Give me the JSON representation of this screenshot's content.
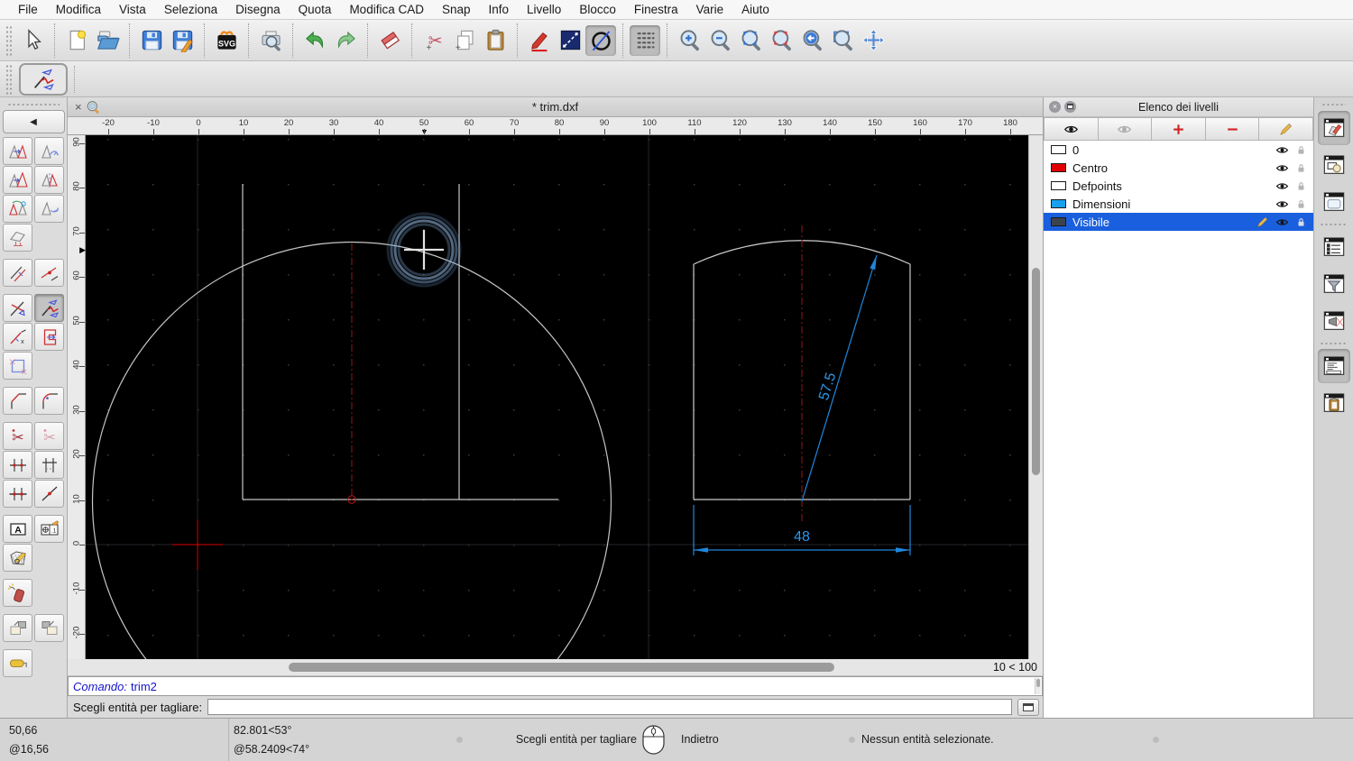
{
  "menu": {
    "items": [
      "File",
      "Modifica",
      "Vista",
      "Seleziona",
      "Disegna",
      "Quota",
      "Modifica CAD",
      "Snap",
      "Info",
      "Livello",
      "Blocco",
      "Finestra",
      "Varie",
      "Aiuto"
    ]
  },
  "toolbar": {
    "buttons": [
      {
        "name": "selection-arrow-icon",
        "icon": "cursor"
      },
      {
        "sep": true
      },
      {
        "name": "new-document-icon",
        "icon": "newfile"
      },
      {
        "name": "open-document-icon",
        "icon": "open"
      },
      {
        "sep": true
      },
      {
        "name": "save-icon",
        "icon": "save"
      },
      {
        "name": "save-as-icon",
        "icon": "saveas"
      },
      {
        "sep": true
      },
      {
        "name": "svg-export-icon",
        "icon": "svg"
      },
      {
        "sep": true
      },
      {
        "name": "print-preview-icon",
        "icon": "printprev"
      },
      {
        "sep": true
      },
      {
        "name": "undo-icon",
        "icon": "undo"
      },
      {
        "name": "redo-icon",
        "icon": "redo"
      },
      {
        "sep": true
      },
      {
        "name": "delete-icon",
        "icon": "eraser"
      },
      {
        "sep": true
      },
      {
        "name": "cut-icon",
        "icon": "cut"
      },
      {
        "name": "copy-icon",
        "icon": "copy"
      },
      {
        "name": "paste-icon",
        "icon": "paste"
      },
      {
        "sep": true
      },
      {
        "name": "edit-pencil-icon",
        "icon": "pencil"
      },
      {
        "name": "measure-icon",
        "icon": "measure"
      },
      {
        "name": "snap-free-icon",
        "icon": "snapfree",
        "active": true
      },
      {
        "sep": true
      },
      {
        "name": "grid-toggle-icon",
        "icon": "grid",
        "active": true
      },
      {
        "sep": true
      },
      {
        "name": "zoom-in-icon",
        "icon": "zin"
      },
      {
        "name": "zoom-out-icon",
        "icon": "zout"
      },
      {
        "name": "zoom-auto-icon",
        "icon": "zauto"
      },
      {
        "name": "zoom-previous-icon",
        "icon": "zprev"
      },
      {
        "name": "zoom-back-icon",
        "icon": "zback"
      },
      {
        "name": "zoom-window-icon",
        "icon": "zwin"
      },
      {
        "name": "zoom-pan-icon",
        "icon": "zpan"
      }
    ]
  },
  "tool_options": {
    "active_tool": "trim-two"
  },
  "palette": {
    "tools": [
      {
        "name": "tool-move",
        "glyph": "tri"
      },
      {
        "name": "tool-rotate",
        "glyph": "trirot"
      },
      {
        "name": "tool-scale",
        "glyph": "tri2"
      },
      {
        "name": "tool-mirror",
        "glyph": "trimir"
      },
      {
        "name": "tool-move-rotate",
        "glyph": "trirot2"
      },
      {
        "name": "tool-rotate-two",
        "glyph": "triflip"
      },
      {
        "name": "tool-project",
        "glyph": "proj",
        "single": true
      },
      {
        "sep": true
      },
      {
        "name": "tool-offset",
        "glyph": "off"
      },
      {
        "name": "tool-lengthen",
        "glyph": "len"
      },
      {
        "sep": true
      },
      {
        "name": "tool-trim",
        "glyph": "trim1"
      },
      {
        "name": "tool-trim-two",
        "glyph": "trim2",
        "selected": true
      },
      {
        "name": "tool-shrink",
        "glyph": "shrink"
      },
      {
        "name": "tool-stretch",
        "glyph": "stretch"
      },
      {
        "name": "tool-break-out",
        "glyph": "brk",
        "single": true
      },
      {
        "sep": true
      },
      {
        "name": "tool-bevel",
        "glyph": "bev"
      },
      {
        "name": "tool-round",
        "glyph": "rnd"
      },
      {
        "sep": true
      },
      {
        "name": "tool-divide",
        "glyph": "sciss"
      },
      {
        "name": "tool-divide-two",
        "glyph": "sciss2"
      },
      {
        "name": "tool-break-gap",
        "glyph": "cross2"
      },
      {
        "name": "tool-break-segment",
        "glyph": "crossd"
      },
      {
        "name": "tool-break-manual",
        "glyph": "cross3"
      },
      {
        "name": "tool-split",
        "glyph": "dotline"
      },
      {
        "sep": true
      },
      {
        "name": "tool-edit-text",
        "glyph": "texta"
      },
      {
        "name": "tool-edit-dimension",
        "glyph": "dimed"
      },
      {
        "name": "tool-edit-hatch",
        "glyph": "hatch",
        "single": true
      },
      {
        "sep": true
      },
      {
        "name": "tool-explode",
        "glyph": "expl",
        "single": true
      },
      {
        "sep": true
      },
      {
        "name": "tool-order-front",
        "glyph": "ord1"
      },
      {
        "name": "tool-order-back",
        "glyph": "ord2"
      },
      {
        "sep": true
      },
      {
        "name": "tool-fill",
        "glyph": "roll",
        "single": true
      }
    ]
  },
  "document": {
    "tab_title": "* trim.dxf"
  },
  "rulers": {
    "horizontal_labels": [
      "-20",
      "-10",
      "0",
      "10",
      "20",
      "30",
      "40",
      "50",
      "60",
      "70",
      "80",
      "90",
      "100",
      "110",
      "120",
      "130",
      "140",
      "150",
      "160",
      "170",
      "180"
    ],
    "vertical_labels": [
      "90",
      "80",
      "70",
      "60",
      "50",
      "40",
      "30",
      "20",
      "10",
      "0",
      "-10",
      "-20"
    ],
    "cursor_h": "50",
    "cursor_v": "66"
  },
  "canvas": {
    "dimensions": {
      "radius_label": "57.5",
      "width_label": "48"
    },
    "colors": {
      "dimension_blue": "#1e87dc",
      "centerline_red": "#8e1212",
      "entity_grey": "#cbcbcb",
      "background": "#000000"
    }
  },
  "layer_panel": {
    "title": "Elenco dei livelli",
    "selection_color": "#1a5fdd",
    "toolbar": [
      {
        "name": "show-all-layers-icon",
        "glyph": "eye"
      },
      {
        "name": "hide-all-layers-icon",
        "glyph": "eyegrey"
      },
      {
        "name": "add-layer-icon",
        "glyph": "plus"
      },
      {
        "name": "remove-layer-icon",
        "glyph": "minus"
      },
      {
        "name": "edit-layer-icon",
        "glyph": "pencilsm"
      }
    ],
    "layers": [
      {
        "name": "0",
        "color": "#ffffff",
        "selected": false
      },
      {
        "name": "Centro",
        "color": "#e00000",
        "selected": false
      },
      {
        "name": "Defpoints",
        "color": "#ffffff",
        "selected": false
      },
      {
        "name": "Dimensioni",
        "color": "#18a0ef",
        "selected": false
      },
      {
        "name": "Visibile",
        "color": "#3d434c",
        "selected": true
      }
    ]
  },
  "right_dock": {
    "items": [
      {
        "name": "dock-layer-list-icon",
        "glyph": "dlayers",
        "active": true
      },
      {
        "name": "dock-block-list-icon",
        "glyph": "dblocks"
      },
      {
        "name": "dock-property-editor-icon",
        "glyph": "dprops"
      },
      {
        "sep": true
      },
      {
        "name": "dock-selection-list-icon",
        "glyph": "dlist"
      },
      {
        "name": "dock-filter-icon",
        "glyph": "dfilter"
      },
      {
        "name": "dock-view-icon",
        "glyph": "dlight"
      },
      {
        "sep": true
      },
      {
        "name": "dock-command-line-icon",
        "glyph": "dcmd",
        "active": true
      },
      {
        "name": "dock-clipboard-icon",
        "glyph": "dclip"
      }
    ]
  },
  "command": {
    "prompt_label": "Comando:",
    "last_command": "trim2",
    "input_label": "Scegli entità per tagliare:",
    "input_value": ""
  },
  "scroll": {
    "zoom_indicator": "10 < 100"
  },
  "statusbar": {
    "abs_coord": "50,66",
    "rel_coord": "@16,56",
    "abs_polar": "82.801<53°",
    "rel_polar": "@58.2409<74°",
    "left_mouse_hint": "Scegli entità per tagliare",
    "right_mouse_hint": "Indietro",
    "selection_status": "Nessun entità selezionate."
  }
}
